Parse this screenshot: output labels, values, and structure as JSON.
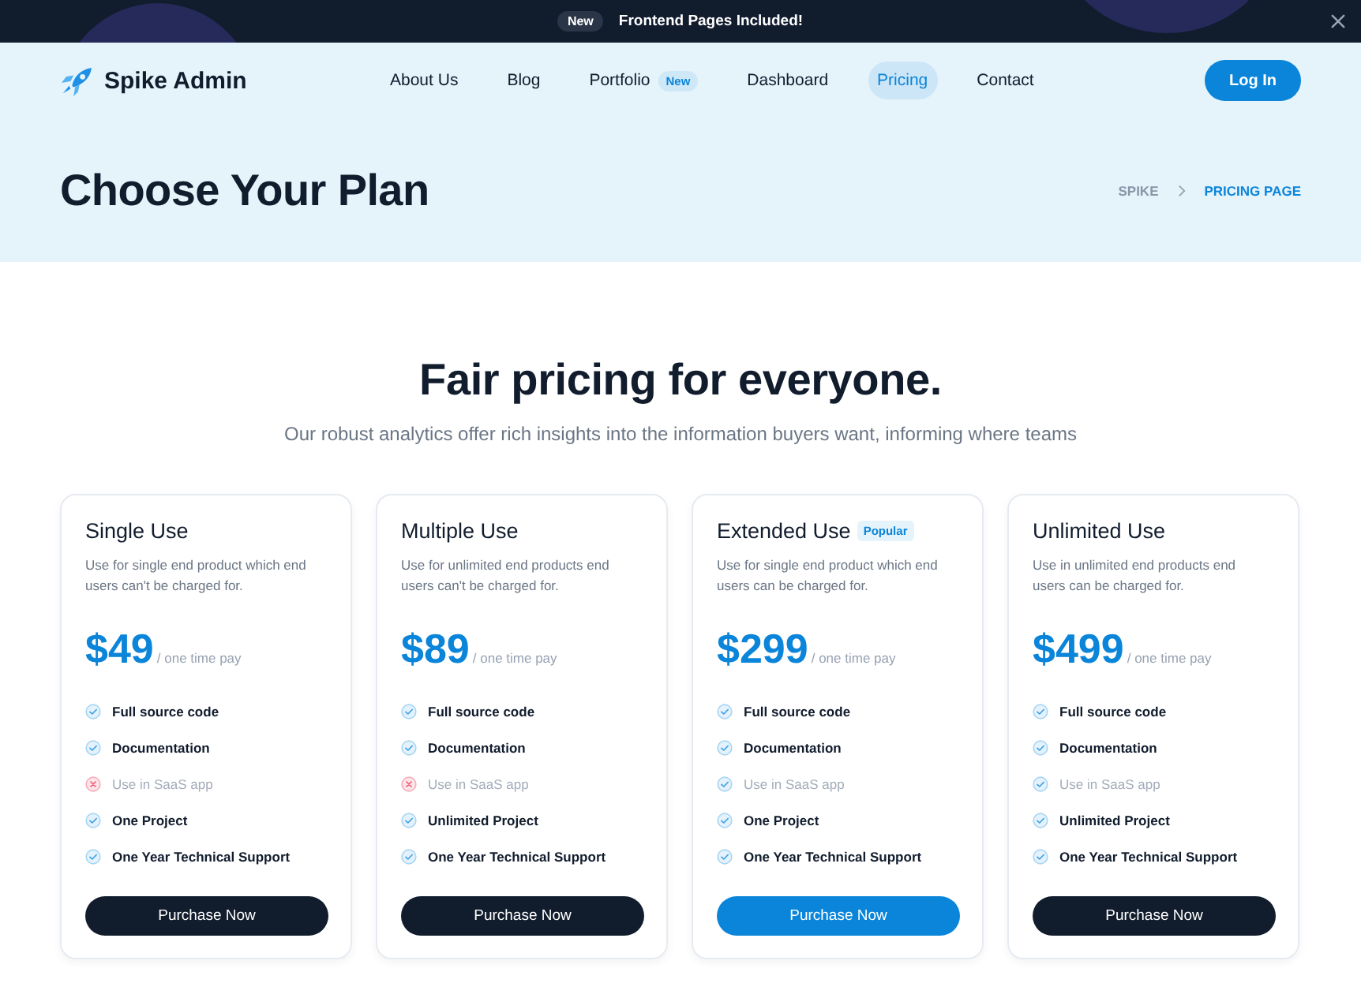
{
  "banner": {
    "badge": "New",
    "text": "Frontend Pages Included!"
  },
  "header": {
    "logo": "Spike Admin",
    "nav": [
      {
        "label": "About Us",
        "selected": false
      },
      {
        "label": "Blog",
        "selected": false
      },
      {
        "label": "Portfolio",
        "selected": false,
        "badge": "New"
      },
      {
        "label": "Dashboard",
        "selected": false
      },
      {
        "label": "Pricing",
        "selected": true
      },
      {
        "label": "Contact",
        "selected": false
      }
    ],
    "login_button": "Log In"
  },
  "page_header": {
    "title": "Choose Your Plan",
    "breadcrumb": [
      {
        "label": "SPIKE",
        "selected": false
      },
      {
        "label": "PRICING PAGE",
        "selected": true
      }
    ]
  },
  "pricing": {
    "heading": "Fair pricing for everyone.",
    "subtitle": "Our robust analytics offer rich insights into the information buyers want, informing where teams",
    "plans": [
      {
        "name": "Single Use",
        "description": "Use for single end product which end users can't be charged for.",
        "price": "$49",
        "period": "/ one time pay",
        "features": [
          {
            "label": "Full source code",
            "included": true,
            "disabled": false
          },
          {
            "label": "Documentation",
            "included": true,
            "disabled": false
          },
          {
            "label": "Use in SaaS app",
            "included": false,
            "disabled": true
          },
          {
            "label": "One Project",
            "included": true,
            "disabled": false
          },
          {
            "label": "One Year Technical Support",
            "included": true,
            "disabled": false
          }
        ],
        "button": "Purchase Now",
        "featured": false
      },
      {
        "name": "Multiple Use",
        "description": "Use for unlimited end products end users can't be charged for.",
        "price": "$89",
        "period": "/ one time pay",
        "features": [
          {
            "label": "Full source code",
            "included": true,
            "disabled": false
          },
          {
            "label": "Documentation",
            "included": true,
            "disabled": false
          },
          {
            "label": "Use in SaaS app",
            "included": false,
            "disabled": true
          },
          {
            "label": "Unlimited Project",
            "included": true,
            "disabled": false
          },
          {
            "label": "One Year Technical Support",
            "included": true,
            "disabled": false
          }
        ],
        "button": "Purchase Now",
        "featured": false
      },
      {
        "name": "Extended Use",
        "badge": "Popular",
        "description": "Use for single end product which end users can be charged for.",
        "price": "$299",
        "period": "/ one time pay",
        "features": [
          {
            "label": "Full source code",
            "included": true,
            "disabled": false
          },
          {
            "label": "Documentation",
            "included": true,
            "disabled": false
          },
          {
            "label": "Use in SaaS app",
            "included": true,
            "disabled": true
          },
          {
            "label": "One Project",
            "included": true,
            "disabled": false
          },
          {
            "label": "One Year Technical Support",
            "included": true,
            "disabled": false
          }
        ],
        "button": "Purchase Now",
        "featured": true
      },
      {
        "name": "Unlimited Use",
        "description": "Use in unlimited end products end users can be charged for.",
        "price": "$499",
        "period": "/ one time pay",
        "features": [
          {
            "label": "Full source code",
            "included": true,
            "disabled": false
          },
          {
            "label": "Documentation",
            "included": true,
            "disabled": false
          },
          {
            "label": "Use in SaaS app",
            "included": true,
            "disabled": true
          },
          {
            "label": "Unlimited Project",
            "included": true,
            "disabled": false
          },
          {
            "label": "One Year Technical Support",
            "included": true,
            "disabled": false
          }
        ],
        "button": "Purchase Now",
        "featured": false
      }
    ]
  }
}
